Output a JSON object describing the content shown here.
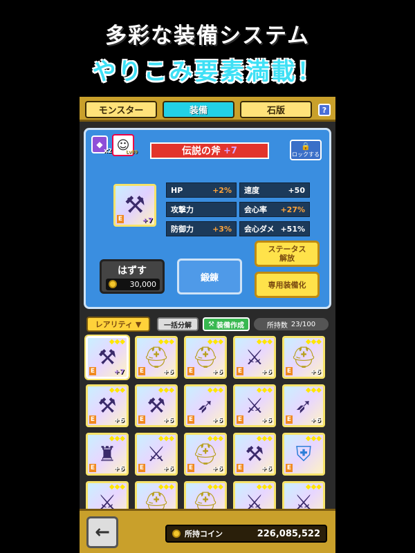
{
  "headline": {
    "line1": "多彩な装備システム",
    "line2": "やりこみ要素満載！"
  },
  "tabs": [
    {
      "label": "モンスター"
    },
    {
      "label": "装備"
    },
    {
      "label": "石版"
    }
  ],
  "help_label": "?",
  "detail": {
    "gem_count": "x2",
    "monster_level": "Lv89",
    "item_name": "伝説の斧",
    "item_plus": "+7",
    "lock_label": "ロックする",
    "item_rank": "E",
    "stats": [
      {
        "label": "HP",
        "value": "+2%"
      },
      {
        "label": "速度",
        "value": "+50"
      },
      {
        "label": "攻撃力",
        "value": ""
      },
      {
        "label": "会心率",
        "value": "+27%"
      },
      {
        "label": "防御力",
        "value": "+3%"
      },
      {
        "label": "会心ダメ",
        "value": "+51%"
      }
    ],
    "unequip": {
      "label": "はずす",
      "cost": "30,000"
    },
    "forge_label": "鍛錬",
    "status_unlock": {
      "line1": "ステータス",
      "line2": "解放"
    },
    "exclusive_label": "専用装備化"
  },
  "toolbar": {
    "rarity_label": "レアリティ ▼",
    "bulk_label": "一括分解",
    "craft_label": "装備作成",
    "owned_label": "所持数",
    "owned_value": "23/100"
  },
  "inventory": [
    {
      "icon": "axe",
      "plus": "+7",
      "selected": true
    },
    {
      "icon": "helmet",
      "plus": "+6"
    },
    {
      "icon": "helmet",
      "plus": "+6"
    },
    {
      "icon": "sword",
      "plus": "+6"
    },
    {
      "icon": "helmet",
      "plus": "+6"
    },
    {
      "icon": "axe",
      "plus": "+6"
    },
    {
      "icon": "axe",
      "plus": "+6"
    },
    {
      "icon": "bow",
      "plus": "+6"
    },
    {
      "icon": "sword",
      "plus": "+6"
    },
    {
      "icon": "bow",
      "plus": "+6"
    },
    {
      "icon": "armor",
      "plus": "+6"
    },
    {
      "icon": "sword",
      "plus": "+6"
    },
    {
      "icon": "helmet",
      "plus": "+6"
    },
    {
      "icon": "axe",
      "plus": "+6"
    },
    {
      "icon": "shield",
      "plus": ""
    },
    {
      "icon": "sword",
      "plus": ""
    },
    {
      "icon": "helmet",
      "plus": ""
    },
    {
      "icon": "helmet",
      "plus": ""
    },
    {
      "icon": "sword",
      "plus": ""
    },
    {
      "icon": "sword",
      "plus": ""
    }
  ],
  "footer": {
    "back_label": "←",
    "coin_label": "所持コイン",
    "coin_value": "226,085,522"
  },
  "colors": {
    "accent": "#22d0e5",
    "panel": "#3a8ee0",
    "gold": "#c9a02b",
    "plus": "#c89bff"
  }
}
